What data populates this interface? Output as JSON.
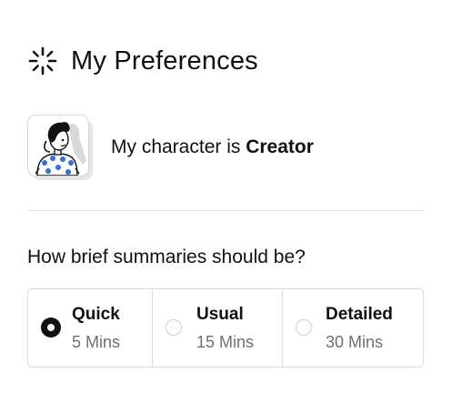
{
  "header": {
    "title": "My Preferences",
    "icon": "loader-icon"
  },
  "character": {
    "prefix": "My character is ",
    "name": "Creator",
    "avatar_icon": "creator-avatar",
    "colors": {
      "dots": "#2f6fe0",
      "hair": "#111111"
    }
  },
  "summaries": {
    "question": "How brief summaries should be?",
    "selected_index": 0,
    "options": [
      {
        "label": "Quick",
        "duration": "5 Mins"
      },
      {
        "label": "Usual",
        "duration": "15 Mins"
      },
      {
        "label": "Detailed",
        "duration": "30 Mins"
      }
    ]
  }
}
